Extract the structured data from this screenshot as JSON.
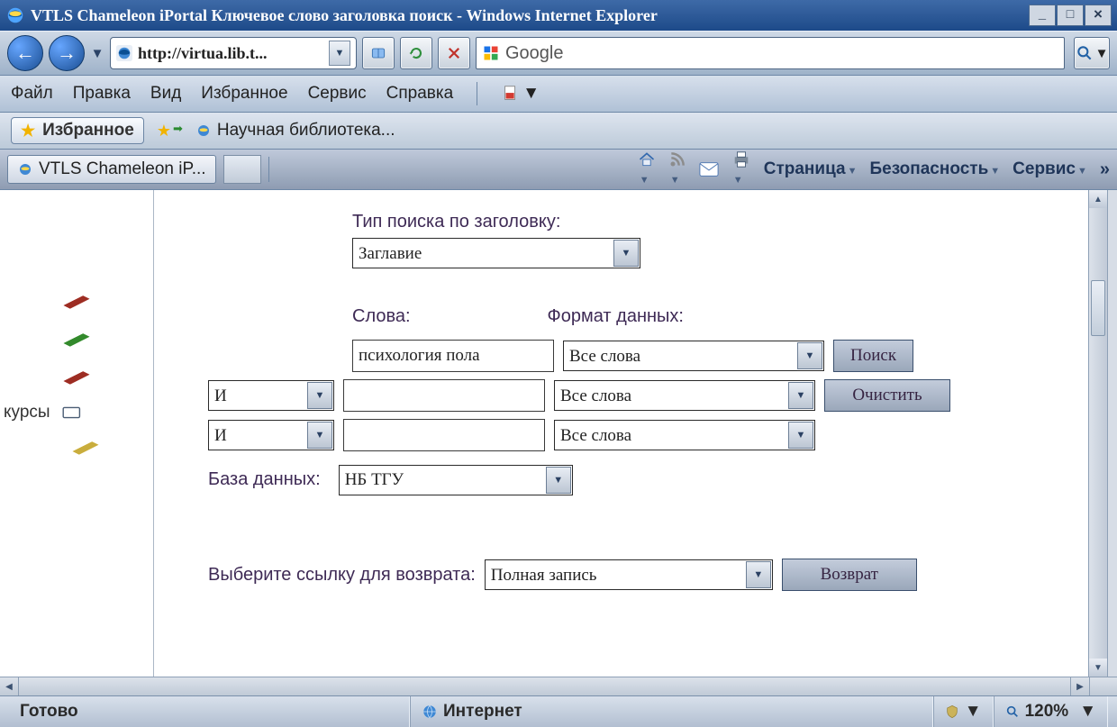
{
  "title": "VTLS Chameleon iPortal Ключевое слово заголовка поиск - Windows Internet Explorer",
  "window_buttons": {
    "min": "_",
    "max": "□",
    "close": "×"
  },
  "nav": {
    "address": "http://virtua.lib.t...",
    "search_placeholder": "Google"
  },
  "menu": [
    "Файл",
    "Правка",
    "Вид",
    "Избранное",
    "Сервис",
    "Справка"
  ],
  "favbar": {
    "favorites": "Избранное",
    "linktext": "Научная библиотека..."
  },
  "tabrow": {
    "tab": "VTLS Chameleon iP...",
    "cmd_page": "Страница",
    "cmd_security": "Безопасность",
    "cmd_tools": "Сервис"
  },
  "sidebar": {
    "kursy": "курсы"
  },
  "form": {
    "label_type": "Тип поиска по заголовку:",
    "select_type": "Заглавие",
    "label_words": "Слова:",
    "label_format": "Формат данных:",
    "input_words1": "психология пола",
    "format1": "Все слова",
    "btn_search": "Поиск",
    "bool2": "И",
    "input_words2": "",
    "format2": "Все слова",
    "btn_clear": "Очистить",
    "bool3": "И",
    "input_words3": "",
    "format3": "Все слова",
    "label_db": "База данных:",
    "select_db": "НБ ТГУ",
    "label_return": "Выберите ссылку для возврата:",
    "select_return": "Полная запись",
    "btn_return": "Возврат"
  },
  "status": {
    "ready": "Готово",
    "zone": "Интернет",
    "zoom": "120%"
  }
}
